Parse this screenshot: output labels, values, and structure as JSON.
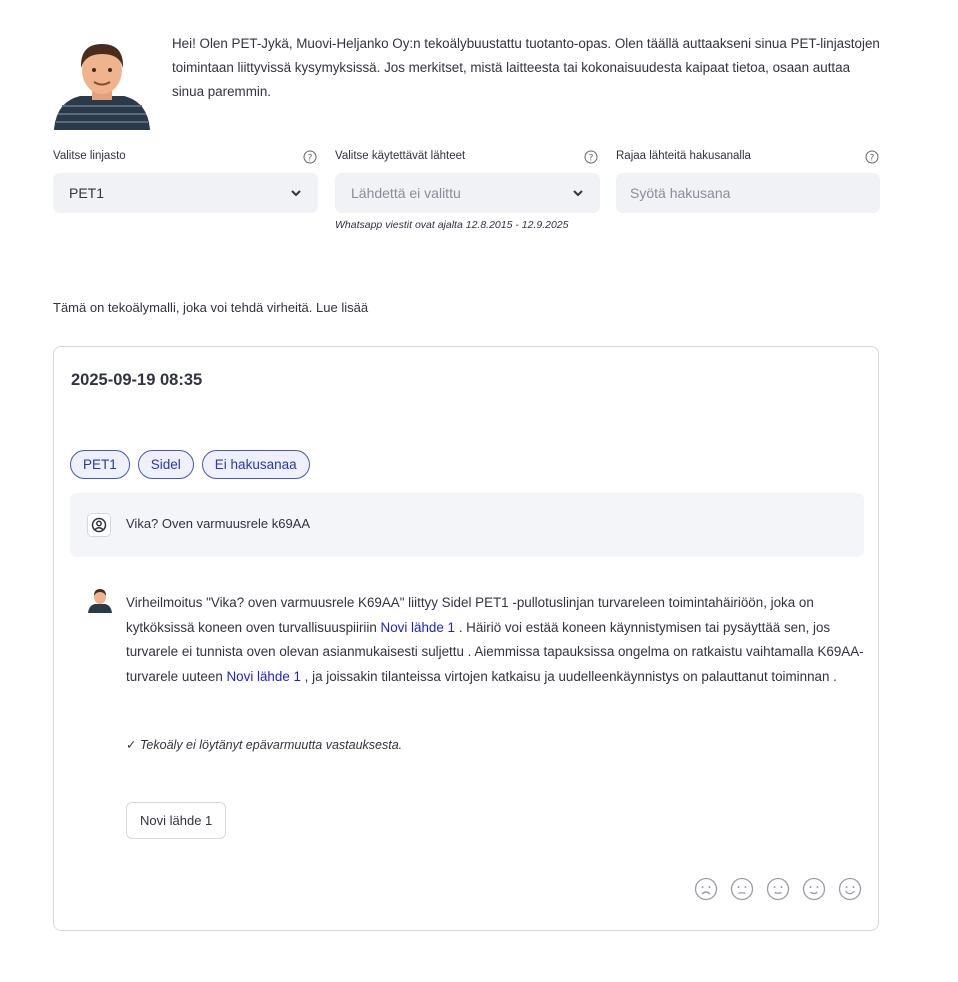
{
  "intro": {
    "text": "Hei! Olen PET-Jykä, Muovi-Heljanko Oy:n tekoälybuustattu tuotanto-opas. Olen täällä auttaakseni sinua PET-linjastojen toimintaan liittyvissä kysymyksissä. Jos merkitset, mistä laitteesta tai kokonaisuudesta kaipaat tietoa, osaan auttaa sinua paremmin."
  },
  "filters": {
    "line": {
      "label": "Valitse linjasto",
      "value": "PET1"
    },
    "sources": {
      "label": "Valitse käytettävät lähteet",
      "placeholder": "Lähdettä ei valittu"
    },
    "keyword": {
      "label": "Rajaa lähteitä hakusanalla",
      "placeholder": "Syötä hakusana"
    }
  },
  "note": "Whatsapp viestit ovat ajalta 12.8.2015 - 12.9.2025",
  "disclaimer": {
    "text": "Tämä on tekoälymalli, joka voi tehdä virheitä.",
    "link": "Lue lisää"
  },
  "conversation": {
    "timestamp": "2025-09-19 08:35",
    "tags": [
      "PET1",
      "Sidel",
      "Ei hakusanaa"
    ],
    "question": "Vika? Oven varmuusrele k69AA",
    "answer": {
      "part1": "Virheilmoitus \"Vika? oven varmuusrele K69AA\" liittyy Sidel PET1 -pullotuslinjan turvareleen toimintahäiriöön, joka on kytköksissä koneen oven turvallisuuspiiriin ",
      "link1": "Novi lähde 1",
      "part2": " . Häiriö voi estää koneen käynnistymisen tai pysäyttää sen, jos turvarele ei tunnista oven olevan asianmukaisesti suljettu . Aiemmissa tapauksissa ongelma on ratkaistu vaihtamalla K69AA-turvarele uuteen ",
      "link2": "Novi lähde 1",
      "part3": " , ja joissakin tilanteissa virtojen katkaisu ja uudelleenkäynnistys on palauttanut toiminnan ."
    },
    "uncertainty": "✓ Tekoäly ei löytänyt epävarmuutta vastauksesta.",
    "source_button": "Novi lähde 1",
    "feedback_icons": [
      "face-very-sad-icon",
      "face-sad-icon",
      "face-neutral-icon",
      "face-happy-icon",
      "face-very-happy-icon"
    ]
  },
  "colors": {
    "accent": "#2936b5",
    "link": "#1a1fe0",
    "field_bg": "#f0f2f6",
    "border": "#d6d8de"
  }
}
